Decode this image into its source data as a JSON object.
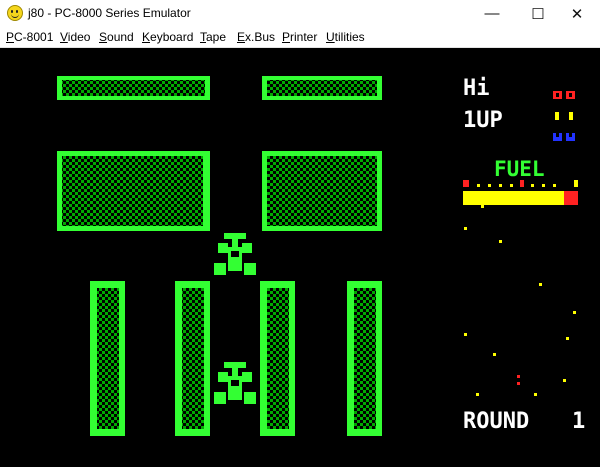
{
  "window": {
    "title": "j80 - PC-8000 Series Emulator",
    "minimize_glyph": "—",
    "maximize_glyph": "☐",
    "close_glyph": "✕"
  },
  "menu": [
    {
      "ul": "P",
      "rest": "C-8001"
    },
    {
      "ul": "V",
      "rest": "ideo"
    },
    {
      "ul": "S",
      "rest": "ound"
    },
    {
      "ul": "K",
      "rest": "eyboard"
    },
    {
      "ul": "T",
      "rest": "ape"
    },
    {
      "ul": "E",
      "rest": "x.Bus"
    },
    {
      "ul": "P",
      "rest": "rinter"
    },
    {
      "ul": "U",
      "rest": "tilities"
    }
  ],
  "hud": {
    "hi_label": "Hi",
    "player_label": "1UP",
    "fuel_label": "FUEL",
    "fuel_level": 0.88,
    "round_label": "ROUND",
    "round_number": "1"
  },
  "colors": {
    "wall": "#33ff33",
    "hatch": "#00aa00",
    "fuel_bar": "#ffff00",
    "fuel_empty": "#ff2222",
    "radar_dot": "#ffff00",
    "radar_enemy": "#ff2222",
    "life_red": "#ff2222",
    "life_yellow": "#ffff00",
    "life_blue": "#2233ff",
    "text": "#ffffff",
    "fuel_text": "#33ff33"
  },
  "icons": {
    "app": "smiley-icon",
    "player_car": "race-car-icon",
    "enemy_car": "race-car-icon"
  }
}
